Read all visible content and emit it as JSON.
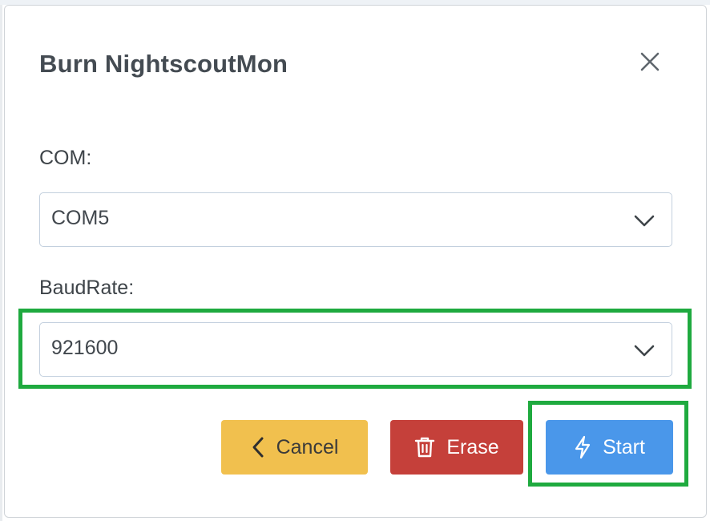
{
  "dialog": {
    "title": "Burn NightscoutMon"
  },
  "form": {
    "com_label": "COM:",
    "com_value": "COM5",
    "baud_label": "BaudRate:",
    "baud_value": "921600"
  },
  "buttons": {
    "cancel_label": "Cancel",
    "erase_label": "Erase",
    "start_label": "Start"
  },
  "icons": {
    "close": "close-icon",
    "chevron": "chevron-down-icon",
    "cancel": "chevron-left-icon",
    "erase": "trash-icon",
    "start": "lightning-icon"
  },
  "colors": {
    "cancel": "#f1c04e",
    "erase": "#c5403a",
    "start": "#4a97ea",
    "highlight": "#1faa3f"
  }
}
